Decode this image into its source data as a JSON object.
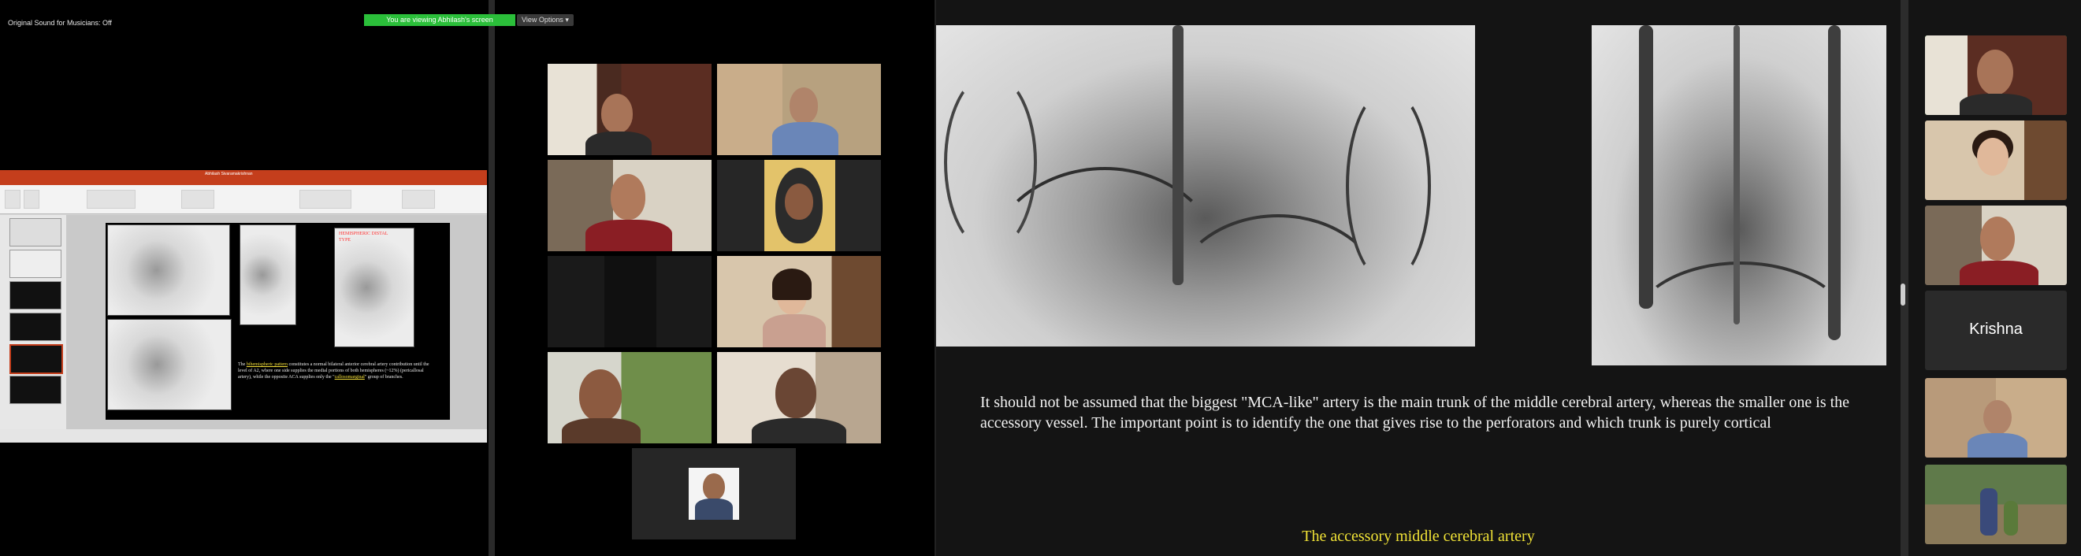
{
  "top": {
    "original_sound": "Original Sound for Musicians: Off",
    "viewing_badge": "You are viewing Abhilash's screen",
    "view_options": "View Options"
  },
  "ppt": {
    "window_title": "Abhilash Sivaramakrishnan",
    "slide_label_red": "HEMISPHERIC DISTAL TYPE",
    "slide_text_pre": "The ",
    "slide_text_hl1": "bihemispheric pattern",
    "slide_text_mid": " constitutes a normal bilateral anterior cerebral artery contribution until the level of A2, where one side supplies the medial portions of both hemispheres (~12%) (pericallosal artery), while the opposite ACA supplies only the \"",
    "slide_text_hl2": "callosomarginal",
    "slide_text_post": "\" group of branches."
  },
  "share": {
    "body_text": "It should not be assumed that the biggest \"MCA-like\" artery is the main trunk of the middle cerebral artery, whereas the smaller one is the accessory vessel. The important point is to identify the one that gives rise to the perforators and which trunk is purely cortical",
    "caption": "The accessory middle cerebral artery"
  },
  "rail": {
    "krishna_name": "Krishna"
  },
  "colors": {
    "active_green": "#2bbf3a",
    "caption_yellow": "#f0e236",
    "ppt_red": "#c43e1c"
  }
}
